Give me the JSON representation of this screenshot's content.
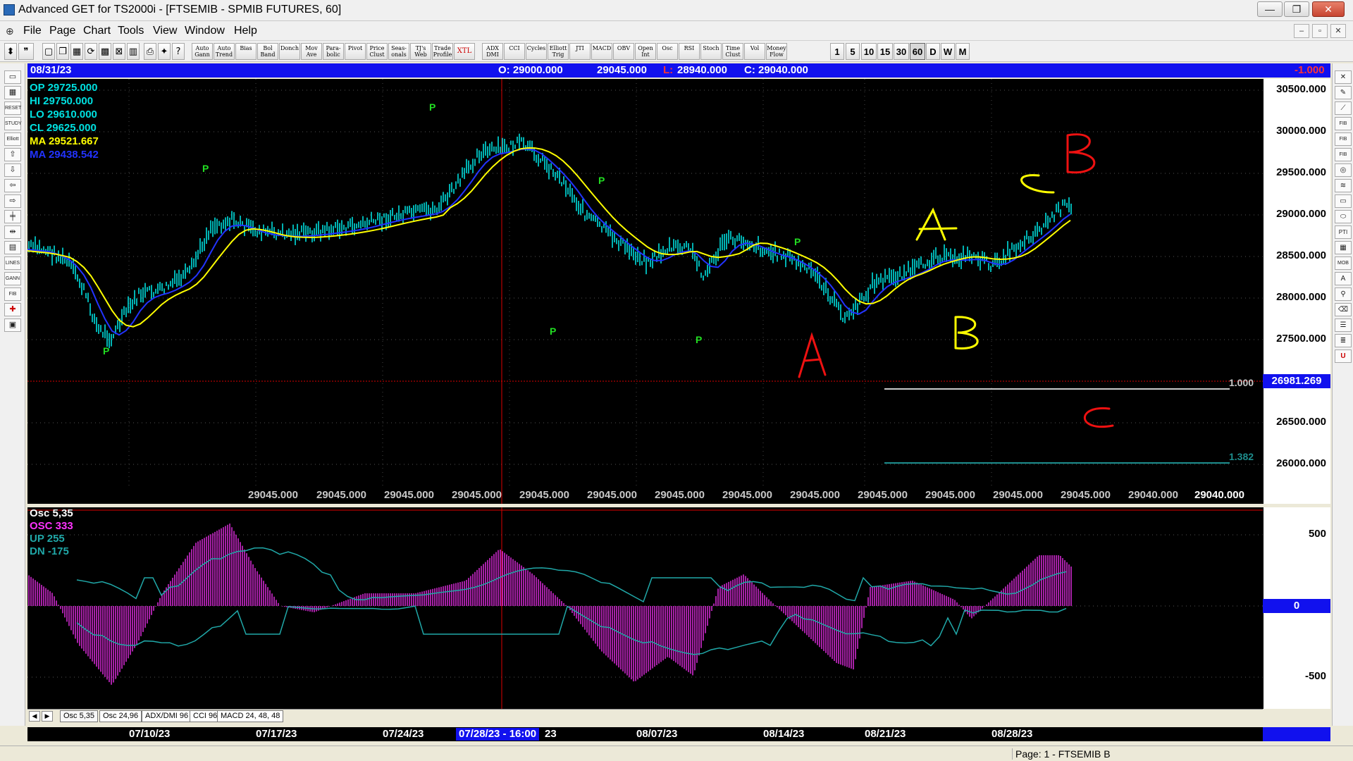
{
  "window": {
    "title": "Advanced GET for TS2000i - [FTSEMIB - SPMIB FUTURES, 60]",
    "min_label": "—",
    "max_label": "❐",
    "close_label": "✕"
  },
  "menu": [
    "File",
    "Page",
    "Chart",
    "Tools",
    "View",
    "Window",
    "Help"
  ],
  "toolbar": {
    "studies": [
      "Auto Gann",
      "Auto Trend",
      "Bias",
      "Bol Band",
      "Donch",
      "Mov Ave",
      "Para-bolic",
      "Pivot",
      "Price Clust",
      "Seas-onals",
      "TJ's Web",
      "Trade Profile",
      "XTL",
      "ADX DMI",
      "CCI",
      "Cycles",
      "Elliott Trig",
      "JTI",
      "MACD",
      "OBV",
      "Open Int",
      "Osc",
      "RSI",
      "Stoch",
      "Time Clust",
      "Vol",
      "Money Flow"
    ],
    "intervals": [
      "1",
      "5",
      "10",
      "15",
      "30",
      "60",
      "D",
      "W",
      "M"
    ],
    "active_interval": "60"
  },
  "infobar": {
    "date": "08/31/23",
    "open": "O: 29000.000",
    "high": "29045.000",
    "low_prefix": "L:",
    "low": "28940.000",
    "close": "C: 29040.000",
    "change": "-1.000"
  },
  "legend": {
    "op": "OP  29725.000",
    "hi": "HI    29750.000",
    "lo": "LO   29610.000",
    "cl": "CL   29625.000",
    "ma1": "MA  29521.667",
    "ma2": "MA  29438.542"
  },
  "price_scale": [
    "30500.000",
    "30000.000",
    "29500.000",
    "29000.000",
    "28500.000",
    "28000.000",
    "27500.000",
    "26500.000",
    "26000.000"
  ],
  "price_tag": "26981.269",
  "fib": {
    "level1": "1.000",
    "level2": "1.382"
  },
  "bottom_values": [
    "29045.000",
    "29045.000",
    "29045.000",
    "29045.000",
    "29045.000",
    "29045.000",
    "29045.000",
    "29045.000",
    "29045.000",
    "29045.000",
    "29045.000",
    "29045.000",
    "29045.000",
    "29040.000",
    "29040.000"
  ],
  "pivot_marker": "P",
  "annotations": {
    "red": [
      "A",
      "B",
      "C"
    ],
    "yellow": [
      "A",
      "B",
      "C"
    ]
  },
  "osc_legend": {
    "title": "Osc 5,35",
    "osc": "OSC 333",
    "up": "UP   255",
    "dn": "DN   -175"
  },
  "osc_scale": [
    "500",
    "0",
    "-500"
  ],
  "tabs": [
    "Osc 5,35",
    "Osc 24,96",
    "ADX/DMI 96",
    "CCI 96",
    "MACD 24, 48, 48"
  ],
  "dates": [
    "07/10/23",
    "07/17/23",
    "07/24/23",
    "07/28/23 - 16:00",
    "23",
    "08/07/23",
    "08/14/23",
    "08/21/23",
    "08/28/23"
  ],
  "status": "Page: 1 - FTSEMIB B",
  "colors": {
    "price_bars": "#00e0e0",
    "ma_fast": "#ffff00",
    "ma_slow": "#2233ff",
    "pivot": "#22dd22",
    "osc": "#ff33ff",
    "band": "#20a8a8",
    "cursor": "#dd0000"
  }
}
